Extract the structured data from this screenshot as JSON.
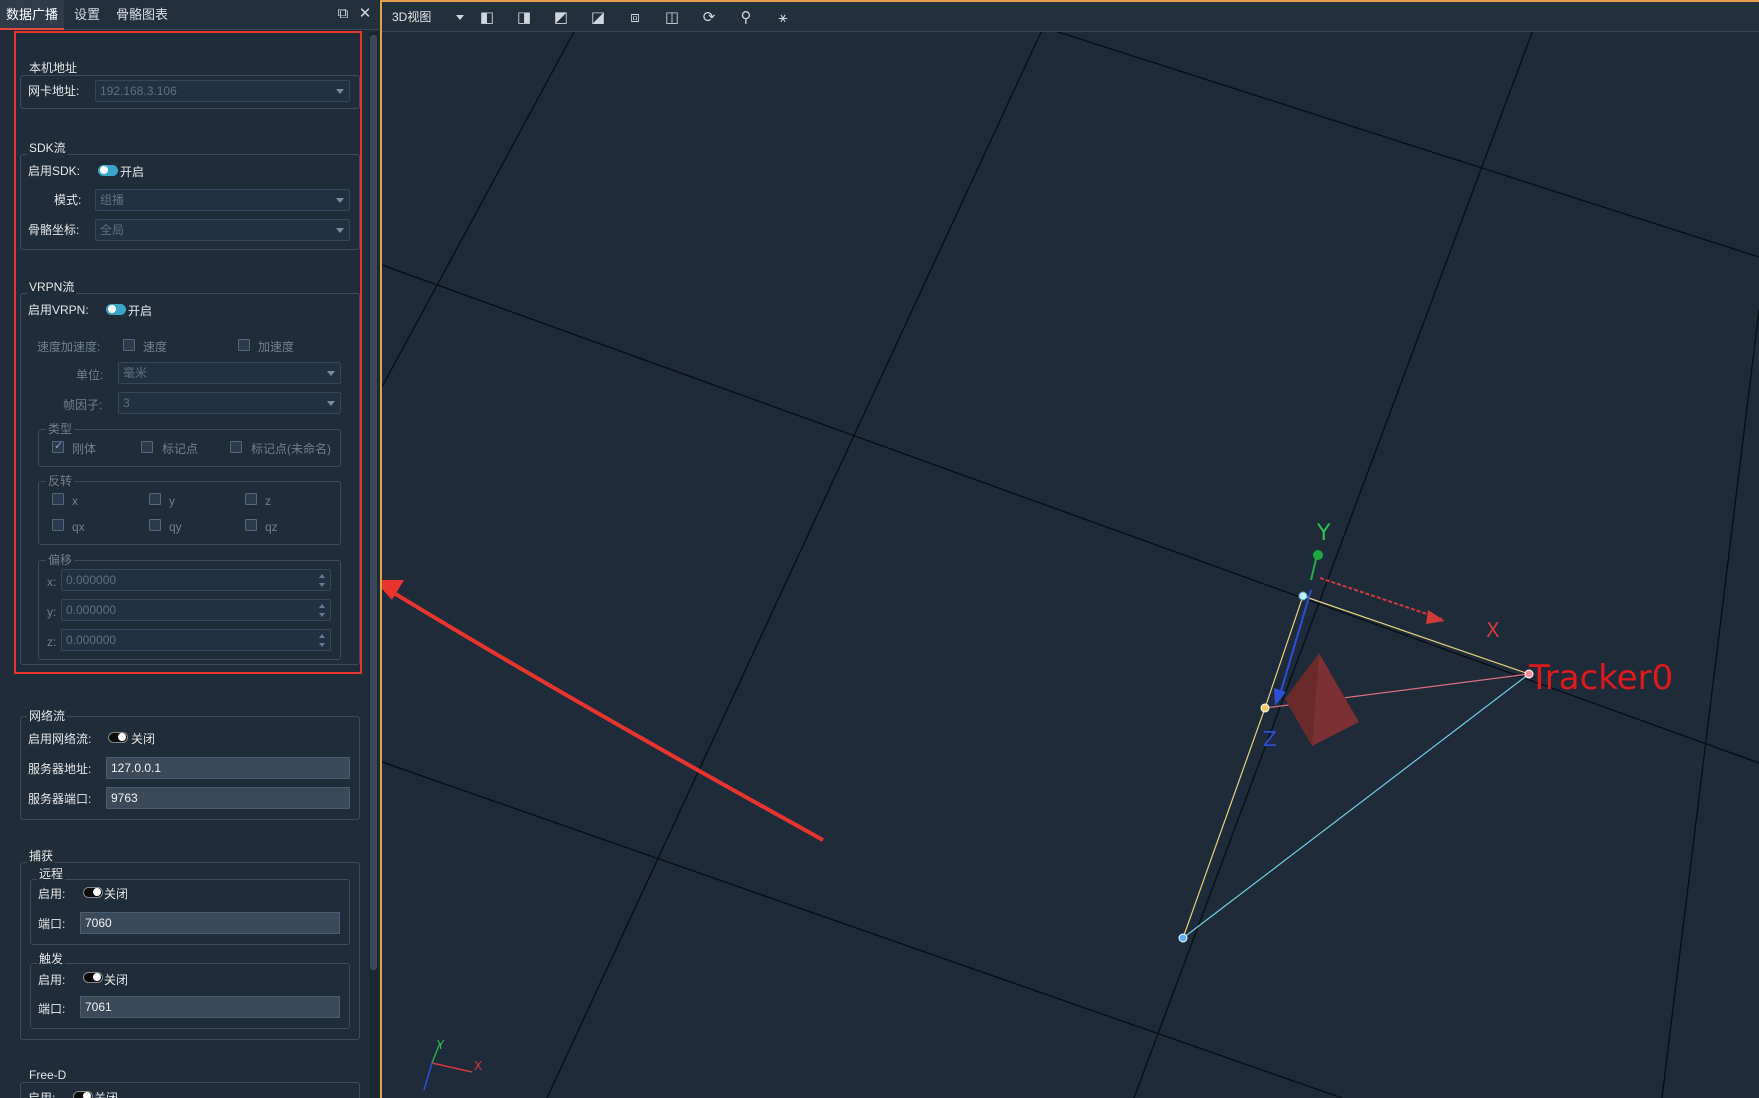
{
  "tabs": [
    {
      "label": "数据广播",
      "active": true
    },
    {
      "label": "设置",
      "active": false
    },
    {
      "label": "骨骼图表",
      "active": false
    }
  ],
  "local": {
    "title": "本机地址",
    "nic_label": "网卡地址:",
    "nic_value": "192.168.3.106"
  },
  "sdk": {
    "title": "SDK流",
    "enable_label": "启用SDK:",
    "enable_state": "开启",
    "mode_label": "模式:",
    "mode_value": "组播",
    "coord_label": "骨骼坐标:",
    "coord_value": "全局"
  },
  "vrpn": {
    "title": "VRPN流",
    "enable_label": "启用VRPN:",
    "enable_state": "开启",
    "velacc_label": "速度加速度:",
    "vel": "速度",
    "acc": "加速度",
    "unit_label": "单位:",
    "unit_value": "毫米",
    "frame_label": "帧因子:",
    "frame_value": "3",
    "type_title": "类型",
    "type_rigid": "刚体",
    "type_marker": "标记点",
    "type_unnamed": "标记点(未命名)",
    "invert_title": "反转",
    "inv_x": "x",
    "inv_y": "y",
    "inv_z": "z",
    "inv_qx": "qx",
    "inv_qy": "qy",
    "inv_qz": "qz",
    "offset_title": "偏移",
    "off_x_label": "x:",
    "off_y_label": "y:",
    "off_z_label": "z:",
    "off_x": "0.000000",
    "off_y": "0.000000",
    "off_z": "0.000000"
  },
  "net": {
    "title": "网络流",
    "enable_label": "启用网络流:",
    "enable_state": "关闭",
    "server_label": "服务器地址:",
    "server_value": "127.0.0.1",
    "port_label": "服务器端口:",
    "port_value": "9763"
  },
  "capture": {
    "title": "捕获",
    "remote_title": "远程",
    "remote_enable_label": "启用:",
    "remote_enable_state": "关闭",
    "remote_port_label": "端口:",
    "remote_port_value": "7060",
    "trigger_title": "触发",
    "trigger_enable_label": "启用:",
    "trigger_enable_state": "关闭",
    "trigger_port_label": "端口:",
    "trigger_port_value": "7061"
  },
  "freed": {
    "title": "Free-D",
    "enable_label": "启用:",
    "enable_state": "关闭"
  },
  "viewport": {
    "view_mode": "3D视图",
    "axis_x": "X",
    "axis_y": "Y",
    "axis_z": "Z",
    "tracker_label": "Tracker0",
    "mini_x": "X",
    "mini_y": "Y"
  },
  "colors": {
    "accent_orange": "#e3a14a",
    "highlight_red": "#e8352b",
    "toggle_on": "#3aa7c8",
    "bg": "#1d2b3a"
  }
}
